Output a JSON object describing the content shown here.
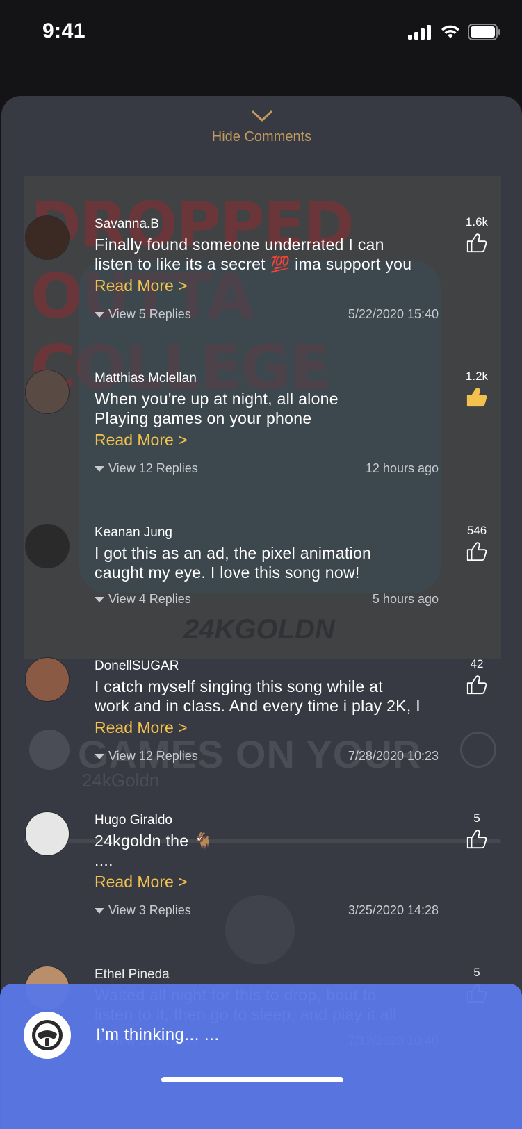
{
  "status": {
    "time": "9:41"
  },
  "header": {
    "hide_label": "Hide Comments"
  },
  "background_player": {
    "song": "GAMES ON YOUR",
    "artist": "24kGoldn",
    "art_title": "DROPPED OUTTA COLLEGE",
    "art_signature": "24KGOLDN"
  },
  "comments": [
    {
      "name": "Savanna.B",
      "text": "Finally found someone underrated I can\nlisten to like its a secret 💯 ima support you",
      "read_more": "Read More >",
      "replies": "View 5 Replies",
      "date": "5/22/2020 15:40",
      "likes": "1.6k",
      "liked": false,
      "avatar_color": "#3b2a24"
    },
    {
      "name": "Matthias Mclellan",
      "text": "When you're up at night, all alone\nPlaying games on your phone",
      "read_more": "Read More >",
      "replies": "View 12 Replies",
      "date": "12 hours ago",
      "likes": "1.2k",
      "liked": true,
      "avatar_color": "#5a4a44"
    },
    {
      "name": "Keanan Jung",
      "text": "I got this as an ad, the pixel animation\ncaught my eye. I love this song now!",
      "read_more": "",
      "replies": "View 4 Replies",
      "date": "5 hours ago",
      "likes": "546",
      "liked": false,
      "avatar_color": "#2a2a2a"
    },
    {
      "name": "DonellSUGAR",
      "text": "I catch myself singing this song while at\nwork and in class. And every time i play 2K, I",
      "read_more": "Read More >",
      "replies": "View 12 Replies",
      "date": "7/28/2020 10:23",
      "likes": "42",
      "liked": false,
      "avatar_color": "#8a5a44"
    },
    {
      "name": "Hugo Giraldo",
      "text": "24kgoldn the 🐐\n....",
      "read_more": "Read More >",
      "replies": "View 3 Replies",
      "date": "3/25/2020 14:28",
      "likes": "5",
      "liked": false,
      "avatar_color": "#e6e6e6"
    },
    {
      "name": "Ethel Pineda",
      "text": "Waited all night for this to drop, bout to\nlisten to it, then go to sleep, and play it all",
      "read_more": "",
      "replies": "View 12 Replies",
      "date": "7/12/2020 10:40",
      "likes": "5",
      "liked": false,
      "avatar_color": "#c89870"
    }
  ],
  "assistant": {
    "thinking_text": "I’m thinking... ..."
  },
  "colors": {
    "accent_gold": "#f2c14e",
    "sheet_bg": "#373a42",
    "assistant_blue": "#5a78e6"
  }
}
